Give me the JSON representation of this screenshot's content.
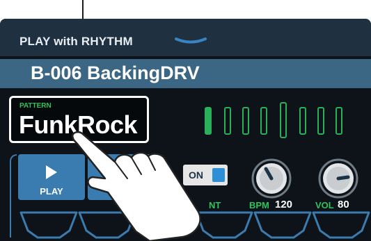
{
  "header": {
    "mode_title": "PLAY with RHYTHM"
  },
  "preset": {
    "name": "B-006 BackingDRV"
  },
  "pattern": {
    "label": "PATTERN",
    "value": "FunkRock"
  },
  "step_indicator": {
    "total_steps": 8,
    "active_step": 1,
    "highlighted_step": 4
  },
  "transport": {
    "play_label": "PLAY"
  },
  "toggle": {
    "label": "ON",
    "partial_label": "NT"
  },
  "bpm": {
    "label": "BPM",
    "value": "120"
  },
  "volume": {
    "label": "VOL",
    "value": "80"
  },
  "colors": {
    "accent_green": "#32c25c",
    "button_blue": "#3a7cb0",
    "toggle_blue": "#2d8fd6",
    "header_bg": "#1f3040",
    "name_bar_bg": "#3b6784"
  },
  "icons": [
    "chevron-down-icon",
    "play-icon",
    "knob-icon",
    "hand-pointer-icon"
  ]
}
